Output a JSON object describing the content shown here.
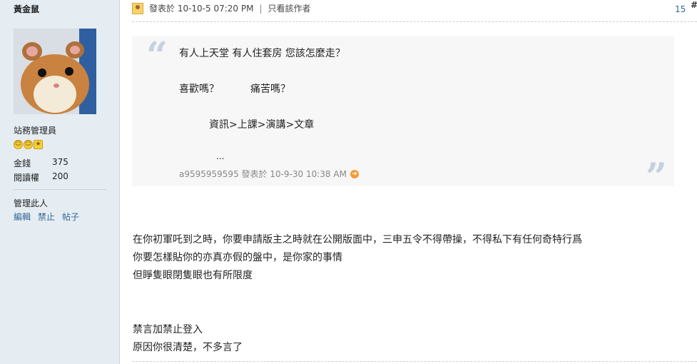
{
  "author": {
    "name": "黃金鼠",
    "group": "站務管理員",
    "stats": [
      {
        "label": "金錢",
        "value": "375"
      },
      {
        "label": "閱讀權",
        "value": "200"
      }
    ],
    "manage_label": "管理此人",
    "actions": [
      "編輯",
      "禁止",
      "帖子"
    ]
  },
  "post": {
    "posted_at": "發表於 10-10-5 07:20 PM",
    "only_author": "只看該作者",
    "floor": "15",
    "hash": "#"
  },
  "quote": {
    "lines": [
      "有人上天堂 有人住套房 您該怎麼走？",
      "喜歡嗎？",
      "痛苦嗎？",
      "資訊>上課>演講>文章",
      "..."
    ],
    "meta": "a9595959595 發表於 10-9-30 10:38 AM"
  },
  "body": {
    "lines": [
      "在你初軍吒到之時，你要申請版主之時就在公開版面中，三申五令不得帶操，不得私下有任何奇特行爲",
      "你要怎樣貼你的亦真亦假的盤中，是你家的事情",
      "但睜隻眼閉隻眼也有所限度",
      "禁言加禁止登入",
      "原因你很清楚，不多言了"
    ]
  }
}
